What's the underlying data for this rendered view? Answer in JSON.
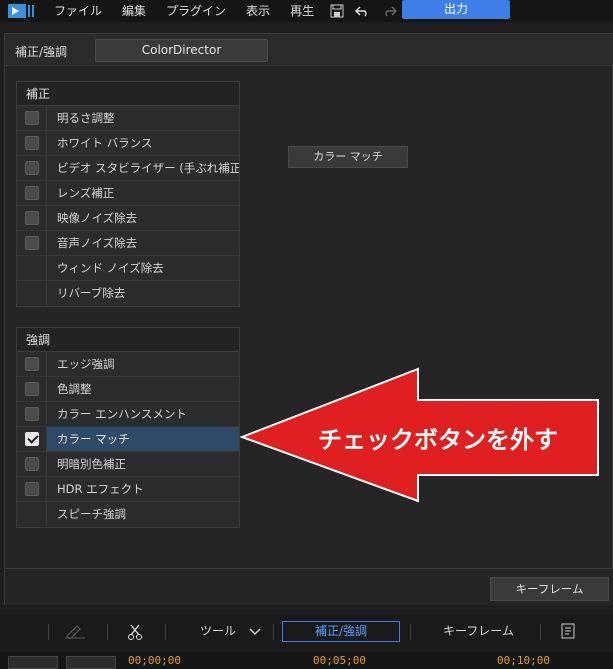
{
  "menu": {
    "items": [
      "ファイル",
      "編集",
      "プラグイン",
      "表示",
      "再生"
    ],
    "export_label": "出力"
  },
  "panel": {
    "title": "補正/強調",
    "colordirector_label": "ColorDirector",
    "color_match_button": "カラー マッチ",
    "keyframe_button": "キーフレーム"
  },
  "correction": {
    "title": "補正",
    "items": [
      {
        "label": "明るさ調整",
        "checkbox": true,
        "checked": false
      },
      {
        "label": "ホワイト バランス",
        "checkbox": true,
        "checked": false
      },
      {
        "label": "ビデオ スタビライザー (手ぶれ補正)",
        "checkbox": true,
        "checked": false
      },
      {
        "label": "レンズ補正",
        "checkbox": true,
        "checked": false
      },
      {
        "label": "映像ノイズ除去",
        "checkbox": true,
        "checked": false
      },
      {
        "label": "音声ノイズ除去",
        "checkbox": true,
        "checked": false
      },
      {
        "label": "ウィンド ノイズ除去",
        "checkbox": false,
        "checked": false
      },
      {
        "label": "リバーブ除去",
        "checkbox": false,
        "checked": false
      }
    ]
  },
  "enhance": {
    "title": "強調",
    "items": [
      {
        "label": "エッジ強調",
        "checkbox": true,
        "checked": false
      },
      {
        "label": "色調整",
        "checkbox": true,
        "checked": false
      },
      {
        "label": "カラー エンハンスメント",
        "checkbox": true,
        "checked": false
      },
      {
        "label": "カラー マッチ",
        "checkbox": true,
        "checked": true
      },
      {
        "label": "明暗別色補正",
        "checkbox": true,
        "checked": false
      },
      {
        "label": "HDR エフェクト",
        "checkbox": true,
        "checked": false
      },
      {
        "label": "スピーチ強調",
        "checkbox": false,
        "checked": false
      }
    ]
  },
  "callout": {
    "text": "チェックボタンを外す",
    "color": "#e02020"
  },
  "bottom_toolbar": {
    "tools_label": "ツール",
    "active_tab": "補正/強調",
    "keyframe_label": "キーフレーム"
  },
  "ruler": {
    "times": [
      "00;00;00",
      "00;05;00",
      "00;10;00"
    ]
  }
}
